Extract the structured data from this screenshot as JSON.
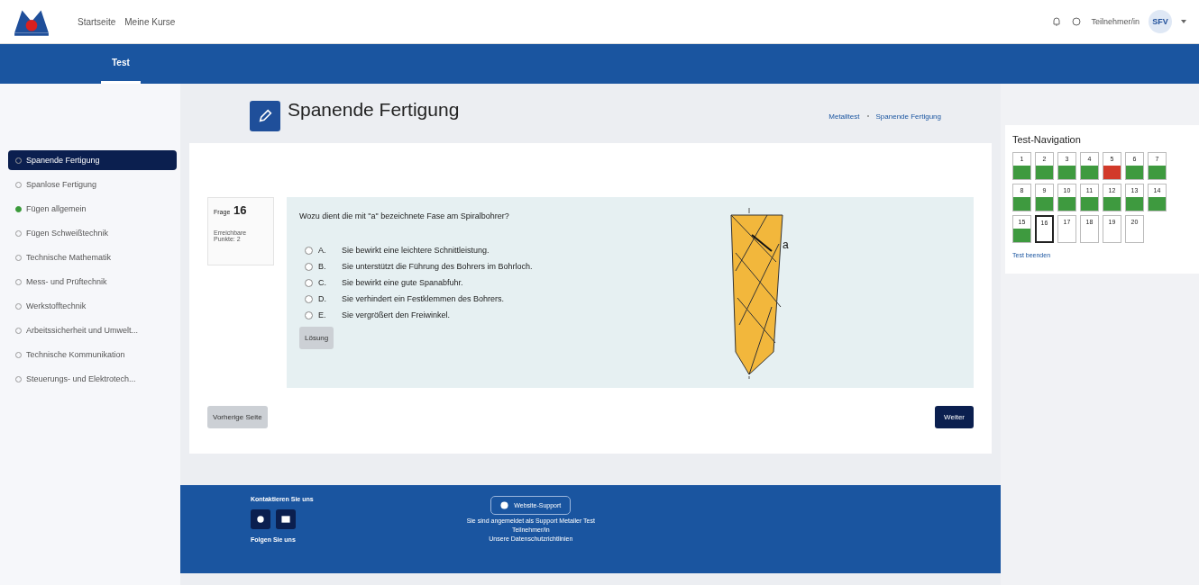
{
  "header": {
    "links": [
      "Startseite",
      "Meine Kurse"
    ],
    "user": "Teilnehmer/in",
    "avatar": "SFV"
  },
  "tabs": [
    {
      "label": "Test",
      "selected": true
    }
  ],
  "sidebar": {
    "items": [
      {
        "label": "Spanende Fertigung",
        "selected": true,
        "done": false
      },
      {
        "label": "Spanlose Fertigung",
        "selected": false,
        "done": false
      },
      {
        "label": "Fügen allgemein",
        "selected": false,
        "done": true
      },
      {
        "label": "Fügen Schweißtechnik",
        "selected": false,
        "done": false
      },
      {
        "label": "Technische Mathematik",
        "selected": false,
        "done": false
      },
      {
        "label": "Mess- und Prüftechnik",
        "selected": false,
        "done": false
      },
      {
        "label": "Werkstofftechnik",
        "selected": false,
        "done": false
      },
      {
        "label": "Arbeitssicherheit und Umwelt...",
        "selected": false,
        "done": false
      },
      {
        "label": "Technische Kommunikation",
        "selected": false,
        "done": false
      },
      {
        "label": "Steuerungs- und Elektrotech...",
        "selected": false,
        "done": false
      }
    ]
  },
  "page": {
    "title": "Spanende Fertigung",
    "breadcrumb": [
      "Metalltest",
      "Spanende Fertigung"
    ]
  },
  "question": {
    "label": "Frage",
    "number": "16",
    "points": "Erreichbare Punkte: 2",
    "text": "Wozu dient die mit \"a\" bezeichnete Fase am Spiralbohrer?",
    "options": [
      {
        "letter": "A.",
        "text": "Sie bewirkt eine leichtere Schnittleistung.",
        "selected": false
      },
      {
        "letter": "B.",
        "text": "Sie unterstützt die Führung des Bohrers im Bohrloch.",
        "selected": false
      },
      {
        "letter": "C.",
        "text": "Sie bewirkt eine gute Spanabfuhr.",
        "selected": false
      },
      {
        "letter": "D.",
        "text": "Sie verhindert ein Festklemmen des Bohrers.",
        "selected": false
      },
      {
        "letter": "E.",
        "text": "Sie vergrößert den Freiwinkel.",
        "selected": false
      }
    ],
    "figure_label": "a",
    "solution_button": "Lösung"
  },
  "buttons": {
    "previous": "Vorherige Seite",
    "next": "Weiter"
  },
  "navigation": {
    "title": "Test-Navigation",
    "finish": "Test beenden",
    "items": [
      {
        "label": "1",
        "kind": "answered",
        "selected": false
      },
      {
        "label": "2",
        "kind": "answered",
        "selected": false
      },
      {
        "label": "3",
        "kind": "answered",
        "selected": false
      },
      {
        "label": "4",
        "kind": "answered",
        "selected": false
      },
      {
        "label": "5",
        "kind": "wrong",
        "selected": false
      },
      {
        "label": "6",
        "kind": "answered",
        "selected": false
      },
      {
        "label": "7",
        "kind": "answered",
        "selected": false
      },
      {
        "label": "8",
        "kind": "answered",
        "selected": false
      },
      {
        "label": "9",
        "kind": "answered",
        "selected": false
      },
      {
        "label": "10",
        "kind": "answered",
        "selected": false
      },
      {
        "label": "11",
        "kind": "answered",
        "selected": false
      },
      {
        "label": "12",
        "kind": "answered",
        "selected": false
      },
      {
        "label": "13",
        "kind": "answered",
        "selected": false
      },
      {
        "label": "14",
        "kind": "answered",
        "selected": false
      },
      {
        "label": "15",
        "kind": "answered",
        "selected": false
      },
      {
        "label": "16",
        "kind": "empty",
        "selected": true
      },
      {
        "label": "17",
        "kind": "empty",
        "selected": false
      },
      {
        "label": "18",
        "kind": "empty",
        "selected": false
      },
      {
        "label": "19",
        "kind": "empty",
        "selected": false
      },
      {
        "label": "20",
        "kind": "empty",
        "selected": false
      }
    ]
  },
  "footer": {
    "contact": "Kontaktieren Sie uns",
    "follow": "Folgen Sie uns",
    "support": "Website-Support",
    "logged_in": "Sie sind angemeldet als Support Metaller Test",
    "role": "Teilnehmer/in",
    "privacy": "Unsere Datenschutzrichtlinien"
  }
}
